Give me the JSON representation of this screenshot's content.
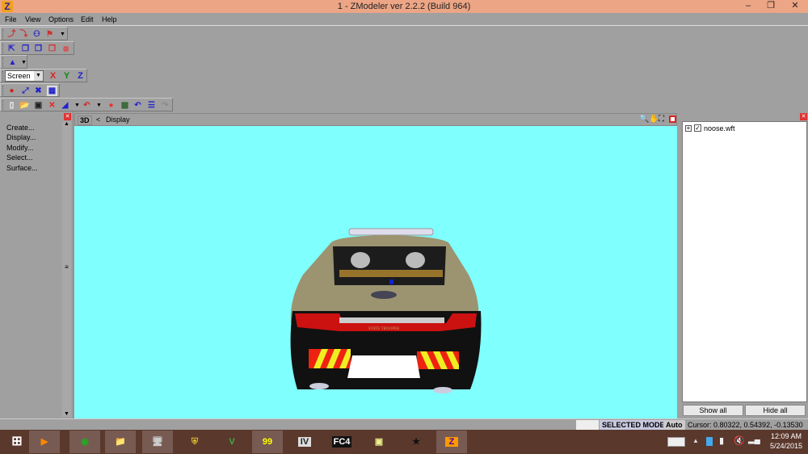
{
  "window": {
    "title": "1 - ZModeler ver 2.2.2 (Build 964)",
    "app_icon": "Z"
  },
  "menu": [
    "File",
    "View",
    "Options",
    "Edit",
    "Help"
  ],
  "toolbar": {
    "coord_space": "Screen",
    "axes": [
      "X",
      "Y",
      "Z"
    ]
  },
  "left_panel": {
    "items": [
      "Create...",
      "Display...",
      "Modify...",
      "Select...",
      "Surface..."
    ]
  },
  "viewport": {
    "mode_label": "3D",
    "nav_label": "<",
    "title": "Display",
    "car_text": "STATE TROOPER",
    "background": "#80ffff"
  },
  "right_panel": {
    "tree": [
      {
        "name": "noose.wft",
        "checked": true
      }
    ],
    "show_all": "Show all",
    "hide_all": "Hide all"
  },
  "status": {
    "mode": "SELECTED MODE",
    "auto": "Auto",
    "cursor": "Cursor: 0.80322, 0.54392, -0.13530"
  },
  "taskbar": {
    "apps": [
      "windows-start",
      "media-player",
      "chrome",
      "file-explorer",
      "task-monitor",
      "lcpd-badge",
      "gta-v",
      "fraps",
      "gta-iv",
      "far-cry-4",
      "sticky-notes",
      "police-badge",
      "zmodeler"
    ],
    "fc4_label": "FC4",
    "fraps_label": "99",
    "iv_label": "IV",
    "zm_label": "Z",
    "time": "12:09 AM",
    "date": "5/24/2015"
  }
}
